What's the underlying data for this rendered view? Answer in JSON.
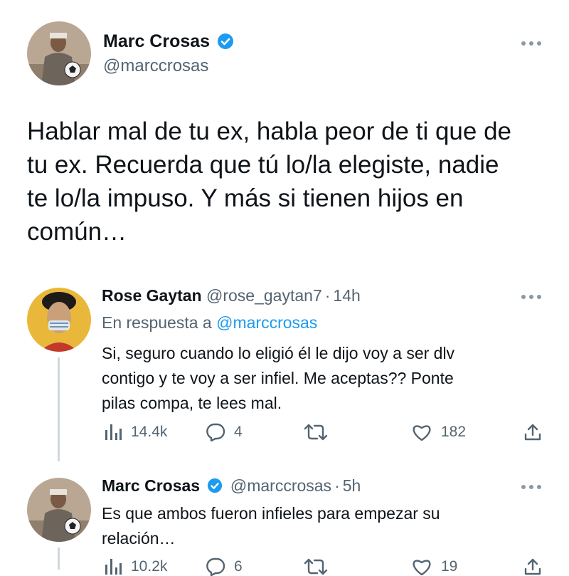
{
  "main_tweet": {
    "author_name": "Marc Crosas",
    "handle": "@marccrosas",
    "text": "Hablar mal de tu ex, habla peor de ti que de tu ex. Recuerda que tú lo/la elegiste, nadie te lo/la impuso. Y más si tienen hijos en común…",
    "lines": [
      "Hablar mal de tu ex, habla peor de ti que de",
      "tu ex. Recuerda que tú lo/la elegiste, nadie",
      "te lo/la impuso. Y más si tienen hijos en",
      "común…"
    ]
  },
  "reply_1": {
    "author_name": "Rose Gaytan",
    "handle": "@rose_gaytan7",
    "separator": "·",
    "time": "14h",
    "replying_prefix": "En respuesta a",
    "replying_to": "@marccrosas",
    "lines": [
      "Si, seguro cuando lo eligió él le dijo voy a ser dlv",
      "contigo y te voy a ser infiel. Me aceptas?? Ponte",
      "pilas compa, te lees mal."
    ],
    "views": "14.4k",
    "replies": "4",
    "likes": "182"
  },
  "reply_2": {
    "author_name": "Marc Crosas",
    "handle": "@marccrosas",
    "separator": "·",
    "time": "5h",
    "lines": [
      "Es que ambos fueron infieles para empezar su",
      "relación…"
    ],
    "views": "10.2k",
    "replies": "6",
    "likes": "19"
  },
  "icons": {
    "verified": "verified-badge-icon",
    "more": "more-options-icon",
    "views": "views-chart-icon",
    "reply": "reply-bubble-icon",
    "retweet": "retweet-icon",
    "like": "heart-icon",
    "share": "share-icon"
  },
  "colors": {
    "accent": "#1d9bf0",
    "muted": "#536471",
    "text": "#0f1419"
  }
}
